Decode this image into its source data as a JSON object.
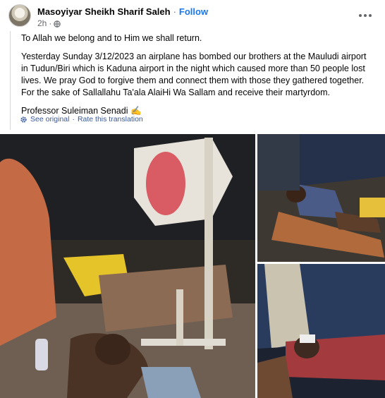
{
  "post": {
    "author": "Masoyiyar Sheikh Sharif Saleh",
    "separator": "·",
    "follow_label": "Follow",
    "time": "2h",
    "time_separator": "·",
    "paragraphs": [
      "To Allah we belong and to Him we shall return.",
      "Yesterday Sunday 3/12/2023 an airplane has bombed our brothers at the Mauludi airport in Tudun/Biri which is Kaduna airport in the night which caused more than 50 people lost lives. We pray God to forgive them and connect them with those they gathered together. For the sake of Sallallahu Ta'ala AlaiHi Wa Sallam and receive their martyrdom.",
      "Professor Suleiman Senadi ✍️"
    ],
    "see_original": "See original",
    "translation_separator": "·",
    "rate_translation": "Rate this translation"
  },
  "icons": {
    "avatar": "profile-picture",
    "privacy": "globe-icon",
    "translate": "gear-icon",
    "more": "more-options-icon"
  },
  "colors": {
    "link": "#1877f2",
    "secondary_text": "#65676b",
    "translate_link": "#385898"
  }
}
